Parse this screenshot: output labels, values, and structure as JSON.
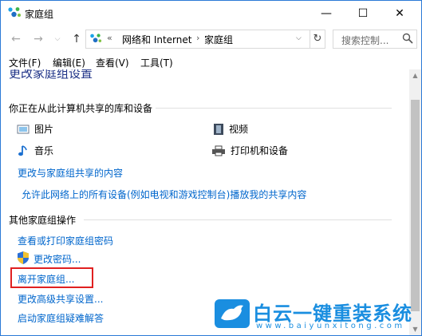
{
  "window": {
    "title": "家庭组",
    "minimize": "—",
    "maximize": "☐",
    "close": "✕"
  },
  "nav": {
    "back": "←",
    "forward": "→",
    "dropdown": "⌵",
    "up": "↑",
    "chevrons": "«",
    "breadcrumb": [
      "网络和 Internet",
      "家庭组"
    ],
    "separator": "›",
    "address_dropdown": "⌵",
    "refresh": "↻",
    "search_placeholder": "搜索控制..."
  },
  "menu": [
    "文件(F)",
    "编辑(E)",
    "查看(V)",
    "工具(T)"
  ],
  "content": {
    "page_title": "更改家庭组设置",
    "shared_section": {
      "header": "你正在从此计算机共享的库和设备",
      "items": [
        "图片",
        "视频",
        "音乐",
        "打印机和设备"
      ]
    },
    "links_top": [
      "更改与家庭组共享的内容",
      "允许此网络上的所有设备(例如电视和游戏控制台)播放我的共享内容"
    ],
    "other_section": {
      "header": "其他家庭组操作",
      "actions": [
        "查看或打印家庭组密码",
        "更改密码...",
        "离开家庭组...",
        "更改高级共享设置...",
        "启动家庭组疑难解答"
      ]
    }
  },
  "scrollbar": {
    "up": "▲",
    "down": "▼"
  },
  "watermark": {
    "title": "白云一键重装系统",
    "url": "www.baiyunxitong.com"
  },
  "colors": {
    "link": "#0066cc",
    "accent": "#1a8ee0",
    "highlight_box": "#e02020",
    "title": "#1e3287"
  }
}
